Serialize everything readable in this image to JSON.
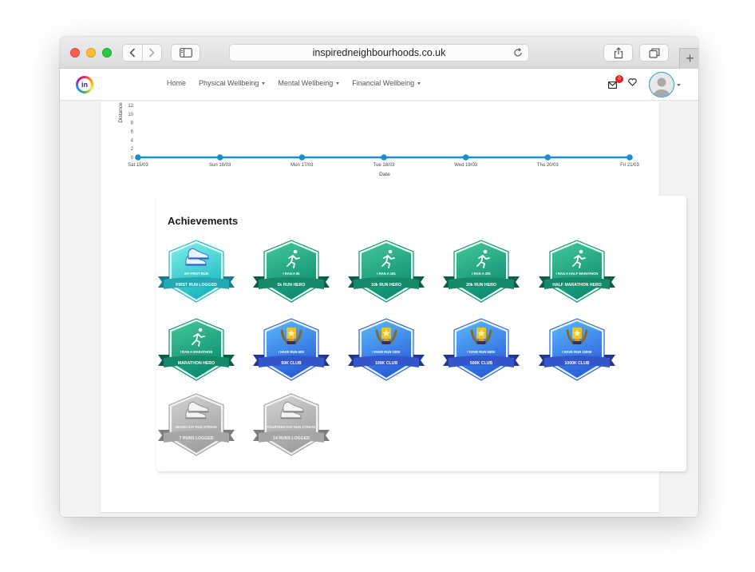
{
  "browser": {
    "url": "inspiredneighbourhoods.co.uk"
  },
  "nav": {
    "logo_text": "in",
    "menu": [
      {
        "label": "Home",
        "dropdown": false
      },
      {
        "label": "Physical Wellbeing",
        "dropdown": true
      },
      {
        "label": "Mental Wellbeing",
        "dropdown": true
      },
      {
        "label": "Financial Wellbeing",
        "dropdown": true
      }
    ],
    "mail_count": "0"
  },
  "chart_data": {
    "type": "line",
    "ylabel": "Distance",
    "xlabel": "Date",
    "x": [
      "Sat 15/03",
      "Sun 16/03",
      "Mon 17/03",
      "Tue 18/03",
      "Wed 19/03",
      "Thu 20/03",
      "Fri 21/03"
    ],
    "values": [
      0,
      0,
      0,
      0,
      0,
      0,
      0
    ],
    "yticks": [
      "0",
      "2",
      "4",
      "6",
      "8",
      "10",
      "12"
    ],
    "ylim": [
      0,
      12
    ],
    "grid": false,
    "color": "#1a8fd0"
  },
  "achievements": {
    "title": "Achievements",
    "badges": [
      {
        "top": "MY FIRST RUN",
        "ribbon": "FIRST RUN LOGGED",
        "style": "teal",
        "icon": "shoe-icon"
      },
      {
        "top": "I RAN A 5k",
        "ribbon": "5k RUN HERO",
        "style": "green",
        "icon": "runner-icon"
      },
      {
        "top": "I RAN A 10k",
        "ribbon": "10k RUN HERO",
        "style": "green",
        "icon": "runner-icon"
      },
      {
        "top": "I RAN A 20k",
        "ribbon": "20k RUN HERO",
        "style": "green",
        "icon": "runner-icon"
      },
      {
        "top": "I RAN A HALF MARATHON",
        "ribbon": "HALF MARATHON HERO",
        "style": "green",
        "icon": "runner-icon"
      },
      {
        "top": "I RAN A MARATHON",
        "ribbon": "MARATHON HERO",
        "style": "green",
        "icon": "runner-icon"
      },
      {
        "top": "I HAVE RUN 50K",
        "ribbon": "50K CLUB",
        "style": "blue",
        "icon": "trophy-icon"
      },
      {
        "top": "I HAVE RUN 100K",
        "ribbon": "100K CLUB",
        "style": "blue",
        "icon": "trophy-icon"
      },
      {
        "top": "I HAVE RUN 500K",
        "ribbon": "500K CLUB",
        "style": "blue",
        "icon": "trophy-icon"
      },
      {
        "top": "I HAVE RUN 1000K",
        "ribbon": "1000K CLUB",
        "style": "blue",
        "icon": "trophy-icon"
      },
      {
        "top": "SEVEN DAY RUN STREAK",
        "ribbon": "7 RUNS LOGGED",
        "style": "gray",
        "icon": "shoe-icon"
      },
      {
        "top": "FOURTEEN DAY RUN STREAK",
        "ribbon": "14 RUNS LOGGED",
        "style": "gray",
        "icon": "shoe-icon"
      }
    ]
  },
  "colors": {
    "teal": "#2fc8c4",
    "green": "#1f9e74",
    "blue": "#3a8be8",
    "gray": "#b0b0b0"
  }
}
